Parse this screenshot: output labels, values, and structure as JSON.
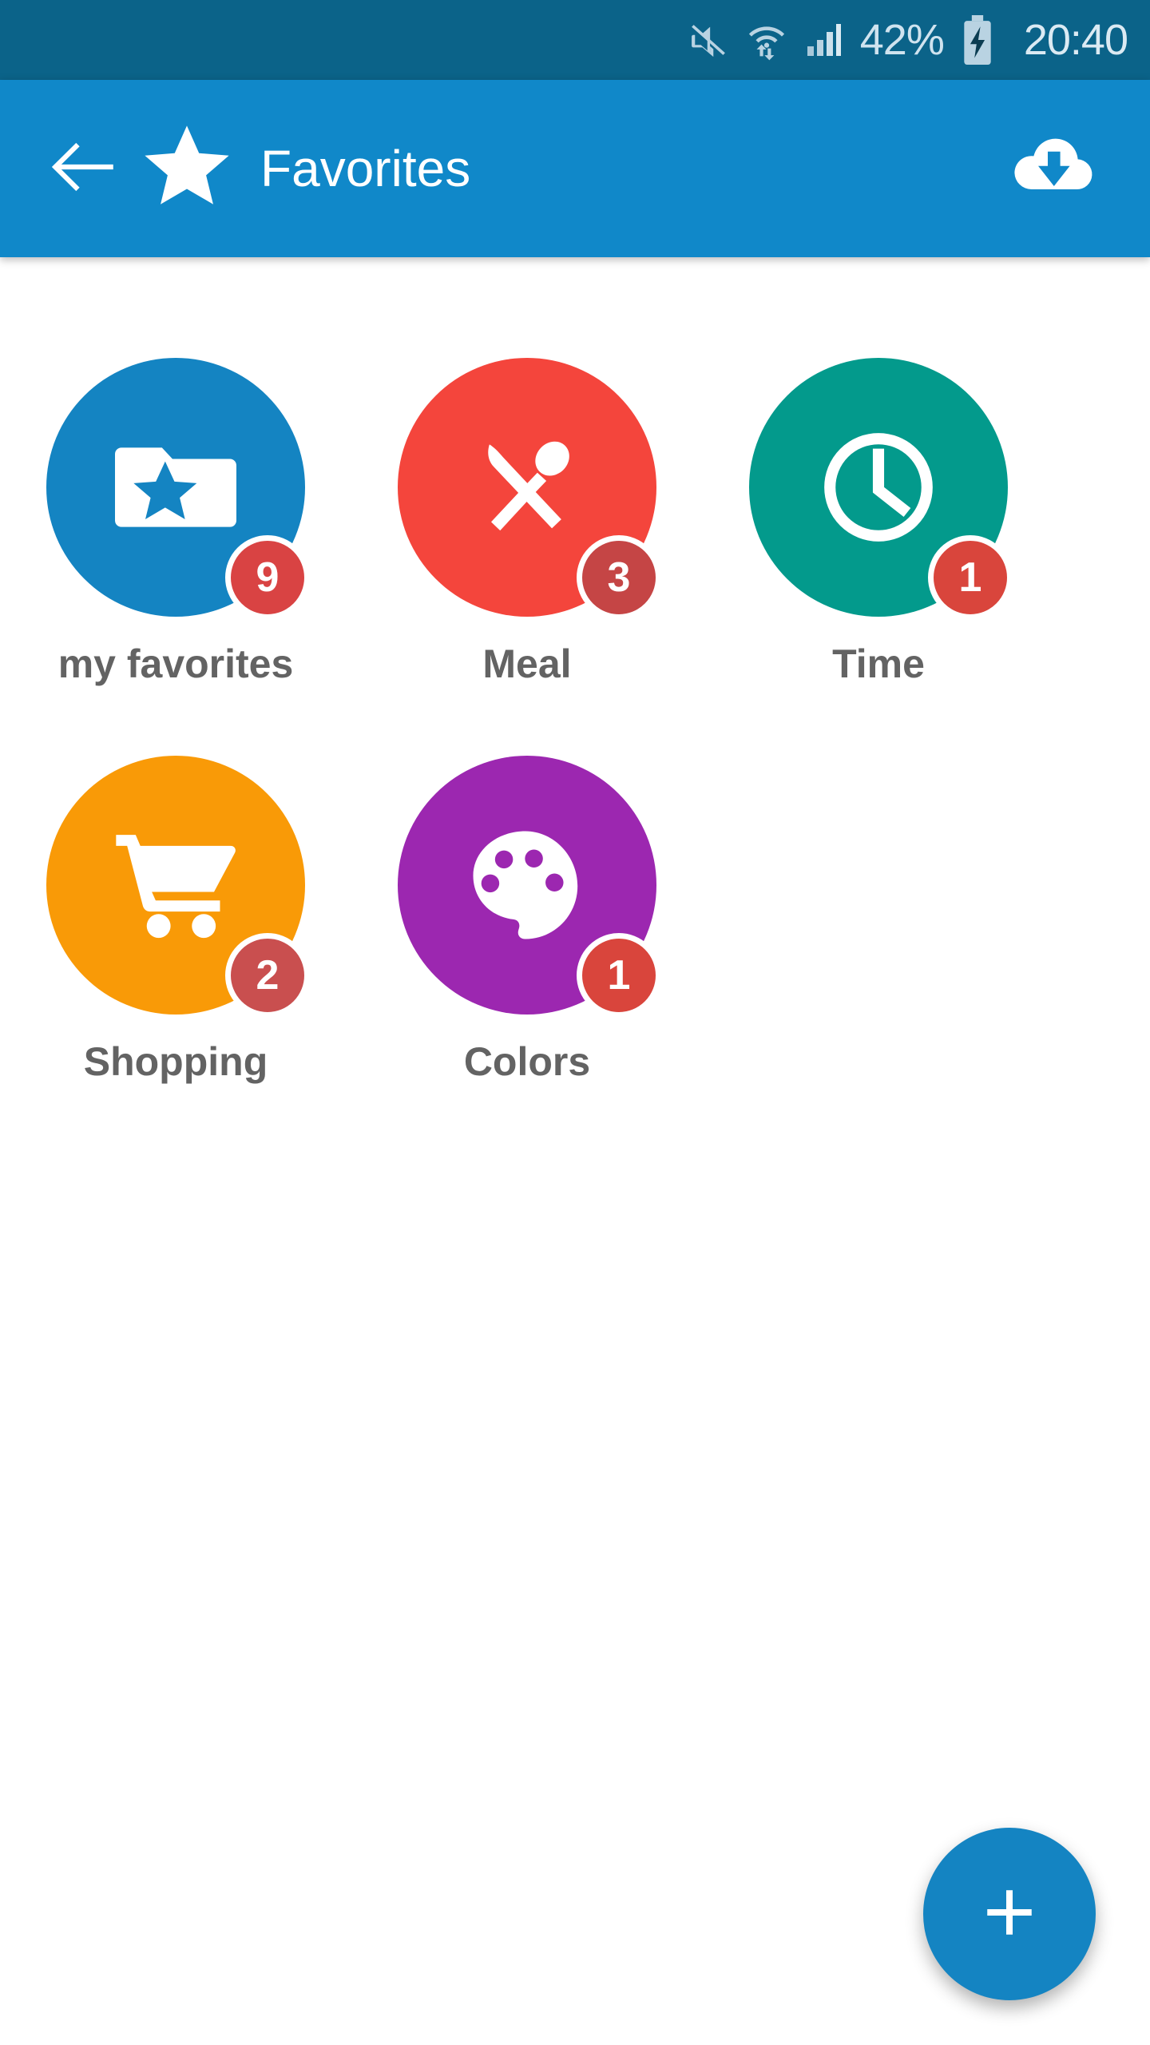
{
  "status_bar": {
    "background_color": "#0b6389",
    "battery_percent": "42%",
    "clock": "20:40",
    "icons": [
      "mute-icon",
      "wifi-transfer-icon",
      "signal-bars-icon",
      "battery-charging-icon"
    ]
  },
  "app_bar": {
    "background_color": "#1088c9",
    "back_icon": "back-arrow-icon",
    "leading_icon": "star-icon",
    "title": "Favorites",
    "action_icon": "cloud-download-icon"
  },
  "grid": {
    "items": [
      {
        "label": "my favorites",
        "icon": "folder-star-icon",
        "color": "#1484c2",
        "badge": "9",
        "badge_color": "#d94343"
      },
      {
        "label": "Meal",
        "icon": "knife-spoon-icon",
        "color": "#f4453c",
        "badge": "3",
        "badge_color": "#c54545"
      },
      {
        "label": "Time",
        "icon": "clock-icon",
        "color": "#039a8c",
        "badge": "1",
        "badge_color": "#d9453c"
      },
      {
        "label": "Shopping",
        "icon": "shopping-cart-icon",
        "color": "#f99a07",
        "badge": "2",
        "badge_color": "#c94f4f"
      },
      {
        "label": "Colors",
        "icon": "palette-icon",
        "color": "#9c27b0",
        "badge": "1",
        "badge_color": "#d9453c"
      }
    ]
  },
  "fab": {
    "icon": "plus-icon",
    "color": "#1484c2"
  }
}
